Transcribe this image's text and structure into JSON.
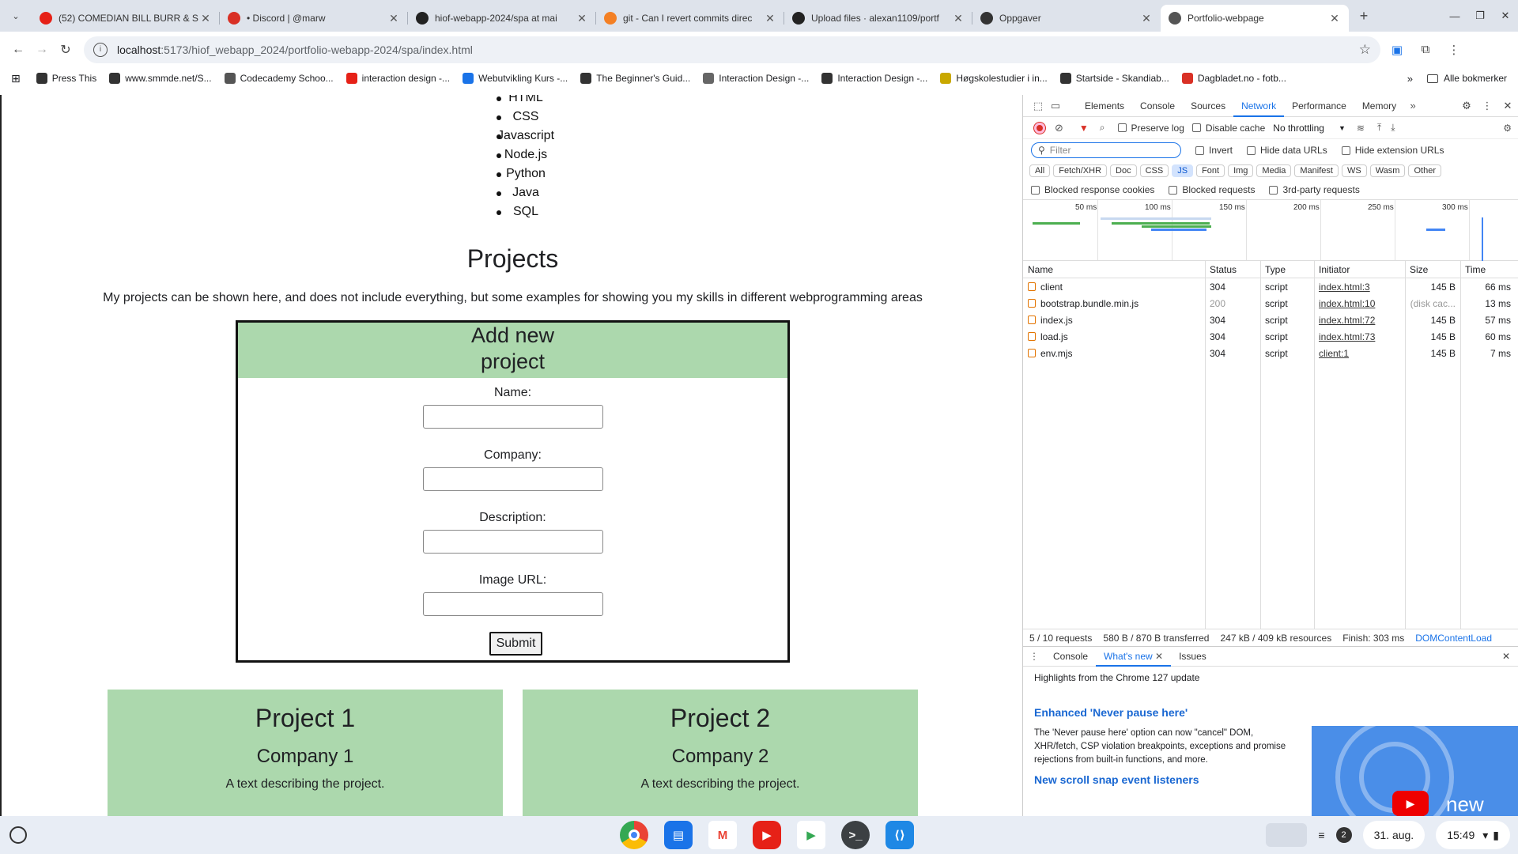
{
  "tabs": [
    {
      "title": "(52) COMEDIAN BILL BURR & S",
      "favicon": "youtube-icon",
      "color": "#e62117"
    },
    {
      "title": "• Discord | @marw",
      "favicon": "discord-icon",
      "color": "#d93025"
    },
    {
      "title": "hiof-webapp-2024/spa at mai",
      "favicon": "github-icon",
      "color": "#222"
    },
    {
      "title": "git - Can I revert commits direc",
      "favicon": "stackoverflow-icon",
      "color": "#f48024"
    },
    {
      "title": "Upload files · alexan1109/portf",
      "favicon": "github-icon",
      "color": "#222"
    },
    {
      "title": "Oppgaver",
      "favicon": "cloud-icon",
      "color": "#333"
    },
    {
      "title": "Portfolio-webpage",
      "favicon": "globe-icon",
      "color": "#555"
    }
  ],
  "url": {
    "host": "localhost",
    "path": ":5173/hiof_webapp_2024/portfolio-webapp-2024/spa/index.html"
  },
  "bookmarks": [
    {
      "label": "Press This",
      "color": "#333"
    },
    {
      "label": "www.smmde.net/S...",
      "color": "#333"
    },
    {
      "label": "Codecademy Schoo...",
      "color": "#555"
    },
    {
      "label": "interaction design -...",
      "color": "#e62117"
    },
    {
      "label": "Webutvikling Kurs -...",
      "color": "#1a73e8"
    },
    {
      "label": "The Beginner's Guid...",
      "color": "#333"
    },
    {
      "label": "Interaction Design -...",
      "color": "#666"
    },
    {
      "label": "Interaction Design -...",
      "color": "#333"
    },
    {
      "label": "Høgskolestudier i in...",
      "color": "#c9a800"
    },
    {
      "label": "Startside - Skandiab...",
      "color": "#333"
    },
    {
      "label": "Dagbladet.no - fotb...",
      "color": "#d93025"
    }
  ],
  "bookmarks_all": "Alle bokmerker",
  "page": {
    "skills": [
      "HTML",
      "CSS",
      "Javascript",
      "Node.js",
      "Python",
      "Java",
      "SQL"
    ],
    "projects_title": "Projects",
    "projects_desc": "My projects can be shown here, and does not include everything, but some examples for showing you my skills in different webprogramming areas",
    "form": {
      "title_line1": "Add new",
      "title_line2": "project",
      "name_label": "Name:",
      "company_label": "Company:",
      "description_label": "Description:",
      "image_label": "Image URL:",
      "submit": "Submit"
    },
    "cards": [
      {
        "title": "Project 1",
        "company": "Company 1",
        "text": "A text describing the project."
      },
      {
        "title": "Project 2",
        "company": "Company 2",
        "text": "A text describing the project."
      }
    ]
  },
  "devtools": {
    "tabs": [
      "Elements",
      "Console",
      "Sources",
      "Network",
      "Performance",
      "Memory"
    ],
    "active_tab": "Network",
    "preserve_log": "Preserve log",
    "disable_cache": "Disable cache",
    "throttling": "No throttling",
    "filter_placeholder": "Filter",
    "invert": "Invert",
    "hide_data_urls": "Hide data URLs",
    "hide_ext_urls": "Hide extension URLs",
    "types": [
      "All",
      "Fetch/XHR",
      "Doc",
      "CSS",
      "JS",
      "Font",
      "Img",
      "Media",
      "Manifest",
      "WS",
      "Wasm",
      "Other"
    ],
    "active_type": "JS",
    "blocked_cookies": "Blocked response cookies",
    "blocked_requests": "Blocked requests",
    "third_party": "3rd-party requests",
    "overview_ticks": [
      "50 ms",
      "100 ms",
      "150 ms",
      "200 ms",
      "250 ms",
      "300 ms"
    ],
    "columns": [
      "Name",
      "Status",
      "Type",
      "Initiator",
      "Size",
      "Time"
    ],
    "rows": [
      {
        "name": "client",
        "status": "304",
        "type": "script",
        "initiator": "index.html:3",
        "size": "145 B",
        "time": "66 ms"
      },
      {
        "name": "bootstrap.bundle.min.js",
        "status": "200",
        "type": "script",
        "initiator": "index.html:10",
        "size": "(disk cac...",
        "time": "13 ms"
      },
      {
        "name": "index.js",
        "status": "304",
        "type": "script",
        "initiator": "index.html:72",
        "size": "145 B",
        "time": "57 ms"
      },
      {
        "name": "load.js",
        "status": "304",
        "type": "script",
        "initiator": "index.html:73",
        "size": "145 B",
        "time": "60 ms"
      },
      {
        "name": "env.mjs",
        "status": "304",
        "type": "script",
        "initiator": "client:1",
        "size": "145 B",
        "time": "7 ms"
      }
    ],
    "summary": {
      "requests": "5 / 10 requests",
      "transferred": "580 B / 870 B transferred",
      "resources": "247 kB / 409 kB resources",
      "finish": "Finish: 303 ms",
      "dcl": "DOMContentLoad"
    },
    "drawer_tabs": [
      "Console",
      "What's new",
      "Issues"
    ],
    "whatsnew": {
      "title": "Highlights from the Chrome 127 update",
      "h1": "Enhanced 'Never pause here'",
      "p1": "The 'Never pause here' option can now \"cancel\" DOM, XHR/fetch, CSP violation breakpoints, exceptions and promise rejections from built-in functions, and more.",
      "h2": "New scroll snap event listeners",
      "img_text": "new"
    }
  },
  "taskbar": {
    "notifications": "2",
    "date": "31. aug.",
    "time": "15:49"
  }
}
